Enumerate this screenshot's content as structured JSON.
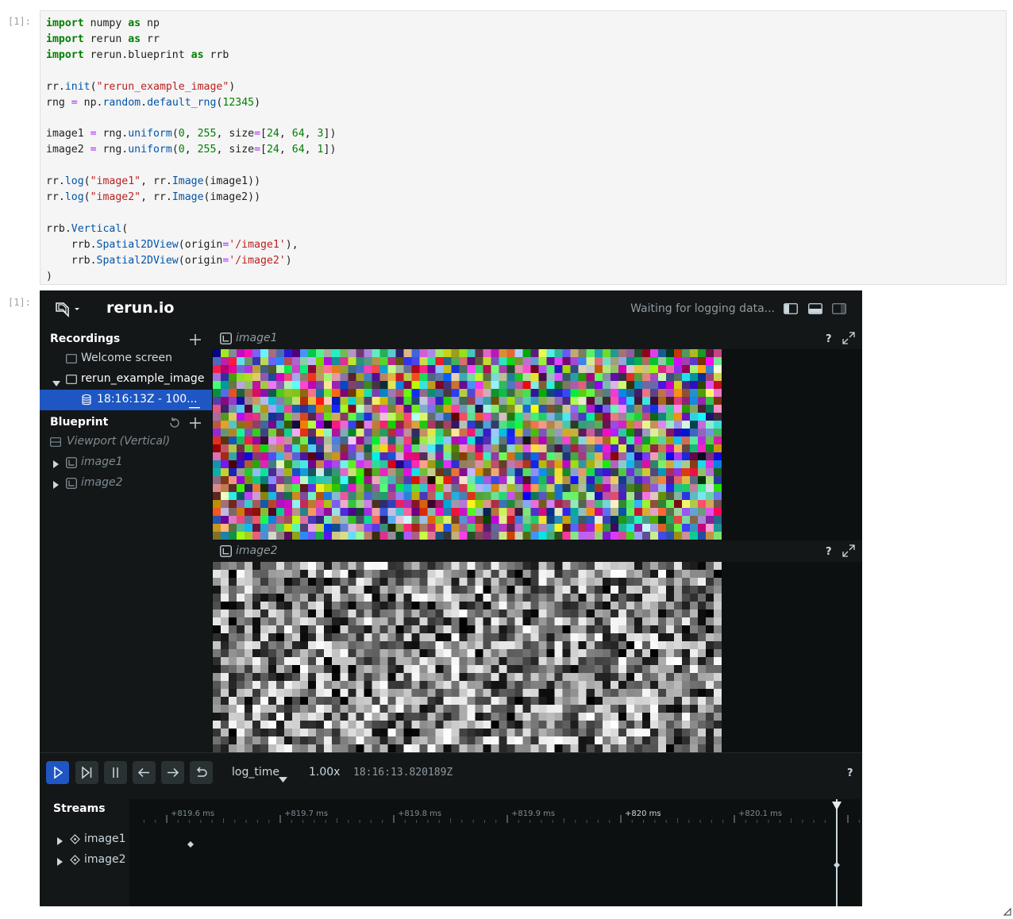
{
  "notebook": {
    "in_prompt": "[1]:",
    "out_prompt": "[1]:",
    "code_lines": [
      [
        [
          "kw",
          "import"
        ],
        [
          "t",
          " numpy "
        ],
        [
          "kw",
          "as"
        ],
        [
          "t",
          " np"
        ]
      ],
      [
        [
          "kw",
          "import"
        ],
        [
          "t",
          " rerun "
        ],
        [
          "kw",
          "as"
        ],
        [
          "t",
          " rr"
        ]
      ],
      [
        [
          "kw",
          "import"
        ],
        [
          "t",
          " rerun.blueprint "
        ],
        [
          "kw",
          "as"
        ],
        [
          "t",
          " rrb"
        ]
      ],
      [],
      [
        [
          "t",
          "rr."
        ],
        [
          "fn",
          "init"
        ],
        [
          "t",
          "("
        ],
        [
          "str",
          "\"rerun_example_image\""
        ],
        [
          "t",
          ")"
        ]
      ],
      [
        [
          "t",
          "rng "
        ],
        [
          "op",
          "="
        ],
        [
          "t",
          " np."
        ],
        [
          "fn",
          "random"
        ],
        [
          "t",
          "."
        ],
        [
          "fn",
          "default_rng"
        ],
        [
          "t",
          "("
        ],
        [
          "num",
          "12345"
        ],
        [
          "t",
          ")"
        ]
      ],
      [],
      [
        [
          "t",
          "image1 "
        ],
        [
          "op",
          "="
        ],
        [
          "t",
          " rng."
        ],
        [
          "fn",
          "uniform"
        ],
        [
          "t",
          "("
        ],
        [
          "num",
          "0"
        ],
        [
          "t",
          ", "
        ],
        [
          "num",
          "255"
        ],
        [
          "t",
          ", size"
        ],
        [
          "op",
          "="
        ],
        [
          "t",
          "["
        ],
        [
          "num",
          "24"
        ],
        [
          "t",
          ", "
        ],
        [
          "num",
          "64"
        ],
        [
          "t",
          ", "
        ],
        [
          "num",
          "3"
        ],
        [
          "t",
          "])"
        ]
      ],
      [
        [
          "t",
          "image2 "
        ],
        [
          "op",
          "="
        ],
        [
          "t",
          " rng."
        ],
        [
          "fn",
          "uniform"
        ],
        [
          "t",
          "("
        ],
        [
          "num",
          "0"
        ],
        [
          "t",
          ", "
        ],
        [
          "num",
          "255"
        ],
        [
          "t",
          ", size"
        ],
        [
          "op",
          "="
        ],
        [
          "t",
          "["
        ],
        [
          "num",
          "24"
        ],
        [
          "t",
          ", "
        ],
        [
          "num",
          "64"
        ],
        [
          "t",
          ", "
        ],
        [
          "num",
          "1"
        ],
        [
          "t",
          "])"
        ]
      ],
      [],
      [
        [
          "t",
          "rr."
        ],
        [
          "fn",
          "log"
        ],
        [
          "t",
          "("
        ],
        [
          "str",
          "\"image1\""
        ],
        [
          "t",
          ", rr."
        ],
        [
          "fn",
          "Image"
        ],
        [
          "t",
          "(image1))"
        ]
      ],
      [
        [
          "t",
          "rr."
        ],
        [
          "fn",
          "log"
        ],
        [
          "t",
          "("
        ],
        [
          "str",
          "\"image2\""
        ],
        [
          "t",
          ", rr."
        ],
        [
          "fn",
          "Image"
        ],
        [
          "t",
          "(image2))"
        ]
      ],
      [],
      [
        [
          "t",
          "rrb."
        ],
        [
          "fn",
          "Vertical"
        ],
        [
          "t",
          "("
        ]
      ],
      [
        [
          "t",
          "    rrb."
        ],
        [
          "fn",
          "Spatial2DView"
        ],
        [
          "t",
          "(origin"
        ],
        [
          "op",
          "="
        ],
        [
          "str",
          "'/image1'"
        ],
        [
          "t",
          "),"
        ]
      ],
      [
        [
          "t",
          "    rrb."
        ],
        [
          "fn",
          "Spatial2DView"
        ],
        [
          "t",
          "(origin"
        ],
        [
          "op",
          "="
        ],
        [
          "str",
          "'/image2'"
        ],
        [
          "t",
          ")"
        ]
      ],
      [
        [
          "t",
          ")"
        ]
      ]
    ]
  },
  "viewer": {
    "brand": "rerun.io",
    "status": "Waiting for logging data...",
    "recordings": {
      "header": "Recordings",
      "welcome": "Welcome screen",
      "app": "rerun_example_image",
      "recording": "18:16:13Z - 100..."
    },
    "blueprint": {
      "header": "Blueprint",
      "viewport": "Viewport (Vertical)",
      "views": [
        "image1",
        "image2"
      ]
    },
    "views": [
      {
        "title": "image1",
        "help": "?",
        "cols": 64,
        "rows": 24,
        "channels": 3
      },
      {
        "title": "image2",
        "help": "?",
        "cols": 64,
        "rows": 24,
        "channels": 1
      }
    ],
    "time_panel": {
      "timeline": "log_time",
      "speed": "1.00x",
      "current_time": "18:16:13.820189Z",
      "help": "?",
      "streams_header": "Streams",
      "streams": [
        "image1",
        "image2"
      ],
      "ticks": [
        "+819.6 ms",
        "+819.7 ms",
        "+819.8 ms",
        "+819.9 ms",
        "+820 ms",
        "+820.1 ms"
      ]
    },
    "colors": {
      "accent": "#1e56c3",
      "panel": "#141718",
      "background": "#0d1011"
    }
  }
}
